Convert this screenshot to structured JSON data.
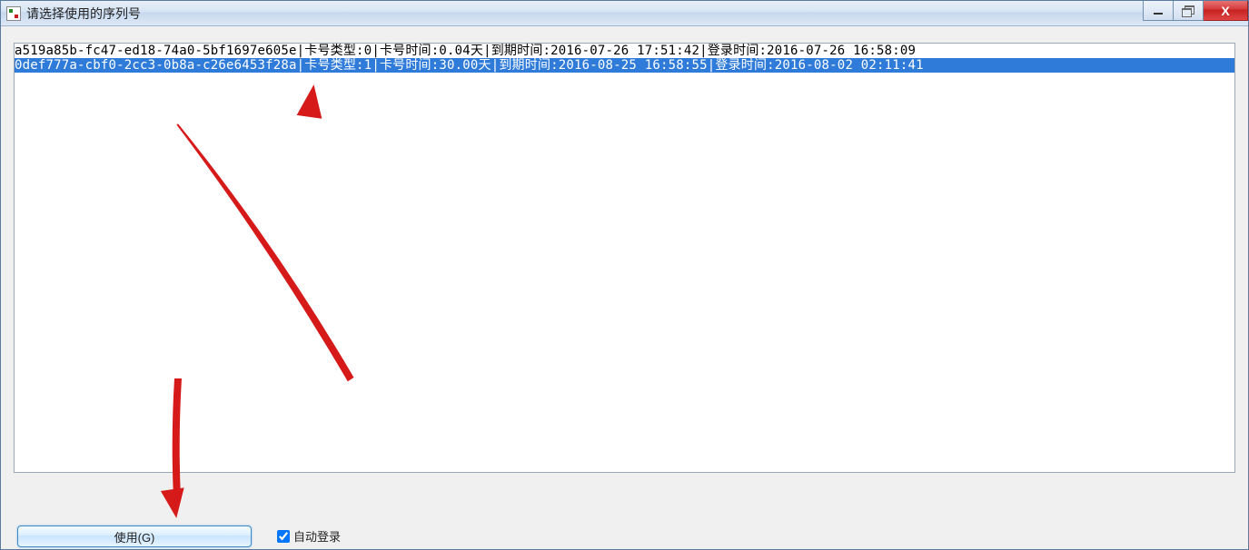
{
  "window": {
    "title": "请选择使用的序列号"
  },
  "list": {
    "rows": [
      {
        "serial": "a519a85b-fc47-ed18-74a0-5bf1697e605e",
        "card_type_label": "卡号类型",
        "card_type_value": "0",
        "card_time_label": "卡号时间",
        "card_time_value": "0.04天",
        "expire_label": "到期时间",
        "expire_value": "2016-07-26 17:51:42",
        "login_label": "登录时间",
        "login_value": "2016-07-26 16:58:09",
        "full": "a519a85b-fc47-ed18-74a0-5bf1697e605e|卡号类型:0|卡号时间:0.04天|到期时间:2016-07-26 17:51:42|登录时间:2016-07-26 16:58:09",
        "selected": false
      },
      {
        "serial": "0def777a-cbf0-2cc3-0b8a-c26e6453f28a",
        "card_type_label": "卡号类型",
        "card_type_value": "1",
        "card_time_label": "卡号时间",
        "card_time_value": "30.00天",
        "expire_label": "到期时间",
        "expire_value": "2016-08-25 16:58:55",
        "login_label": "登录时间",
        "login_value": "2016-08-02 02:11:41",
        "full": "0def777a-cbf0-2cc3-0b8a-c26e6453f28a|卡号类型:1|卡号时间:30.00天|到期时间:2016-08-25 16:58:55|登录时间:2016-08-02 02:11:41",
        "selected": true
      }
    ]
  },
  "buttons": {
    "use_label": "使用(G)"
  },
  "checkbox": {
    "auto_login_label": "自动登录",
    "auto_login_checked": true
  },
  "colors": {
    "selection_bg": "#2f7bd9",
    "annotation_red": "#d61a1a",
    "button_border": "#3a8ac8"
  }
}
